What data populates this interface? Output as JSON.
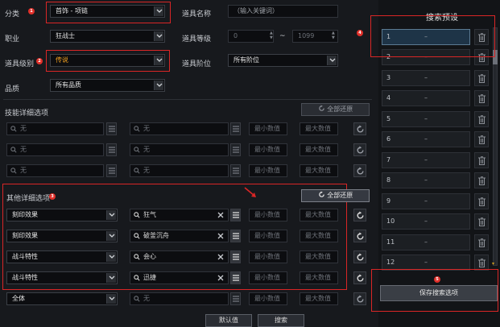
{
  "labels": {
    "category": "分类",
    "item_name": "道具名称",
    "job": "职业",
    "item_level": "道具等级",
    "item_grade": "道具级别",
    "item_tier": "道具阶位",
    "quality": "品质",
    "skill_detail": "技能详细选项",
    "other_detail": "其他详细选项",
    "preset_title": "搜索预设",
    "range_sep": "~"
  },
  "values": {
    "category": "首饰 - 项链",
    "item_name_placeholder": "（输入关键词）",
    "job": "狂战士",
    "level_min": "0",
    "level_max": "1099",
    "grade": "传说",
    "tier": "所有阶位",
    "quality": "所有品质"
  },
  "buttons": {
    "reset_all": "全部还原",
    "defaults": "默认值",
    "search": "搜索",
    "save_preset": "保存搜索选项"
  },
  "skill_rows": [
    {
      "a": "无",
      "b": "无",
      "min": "最小数值",
      "max": "最大数值"
    },
    {
      "a": "无",
      "b": "无",
      "min": "最小数值",
      "max": "最大数值"
    },
    {
      "a": "无",
      "b": "无",
      "min": "最小数值",
      "max": "最大数值"
    }
  ],
  "other_rows": [
    {
      "type": "刻印效果",
      "name": "狂气",
      "min": "最小数值",
      "max": "最大数值"
    },
    {
      "type": "刻印效果",
      "name": "破釜沉舟",
      "min": "最小数值",
      "max": "最大数值"
    },
    {
      "type": "战斗特性",
      "name": "会心",
      "min": "最小数值",
      "max": "最大数值"
    },
    {
      "type": "战斗特性",
      "name": "迅捷",
      "min": "最小数值",
      "max": "最大数值"
    }
  ],
  "last_row": {
    "type": "全体",
    "name": "无",
    "min": "最小数值",
    "max": "最大数值"
  },
  "presets": [
    {
      "num": "1",
      "value": "–"
    },
    {
      "num": "2",
      "value": "–"
    },
    {
      "num": "3",
      "value": "–"
    },
    {
      "num": "4",
      "value": "–"
    },
    {
      "num": "5",
      "value": "–"
    },
    {
      "num": "6",
      "value": "–"
    },
    {
      "num": "7",
      "value": "–"
    },
    {
      "num": "8",
      "value": "–"
    },
    {
      "num": "9",
      "value": "–"
    },
    {
      "num": "10",
      "value": "–"
    },
    {
      "num": "11",
      "value": "–"
    },
    {
      "num": "12",
      "value": "–"
    }
  ],
  "badges": [
    "1",
    "2",
    "3",
    "4",
    "5"
  ],
  "colors": {
    "highlight_red": "#d92626",
    "grade_legendary": "#f0a020",
    "selected_row": "#1e3447"
  },
  "icons": [
    "search-icon",
    "list-icon",
    "clear-icon",
    "refresh-icon",
    "trash-icon",
    "dropdown-arrow-icon"
  ]
}
